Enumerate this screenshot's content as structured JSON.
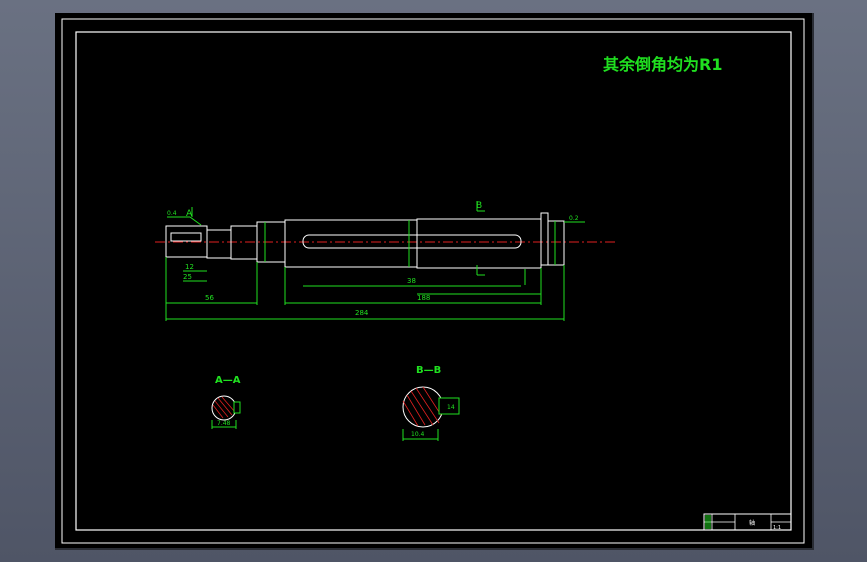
{
  "drawing": {
    "note": "其余倒角均为R1",
    "section_a": "A—A",
    "section_b": "B—B",
    "view_mark_a": "A",
    "view_mark_b": "B",
    "dims": {
      "overall_length": "284",
      "long_body": "188",
      "left_length": "56",
      "left_width": "25",
      "left_upper": "12",
      "key_width": "38",
      "section_a_dim": "7.48",
      "section_b_dim": "10.4",
      "left_callout": "0.4",
      "right_callout": "0.2",
      "section_b_depth": "14"
    },
    "title_block": {
      "title_cell": "轴",
      "scale": "1:1"
    }
  },
  "colors": {
    "background": "#000000",
    "border": "#ffffff",
    "annotation": "#20e020",
    "centerline": "#e02020"
  }
}
